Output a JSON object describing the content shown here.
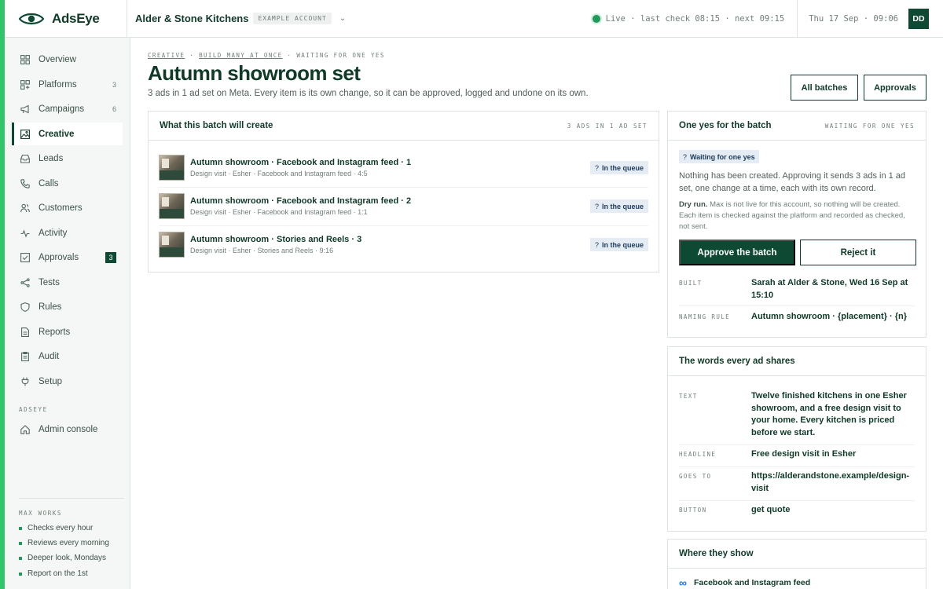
{
  "brand": {
    "name": "AdsEye"
  },
  "account": {
    "name": "Alder & Stone Kitchens",
    "tag": "EXAMPLE ACCOUNT"
  },
  "status": {
    "live_text": "Live · last check 08:15 · next 09:15",
    "datetime": "Thu 17 Sep · 09:06",
    "avatar": "DD"
  },
  "sidebar": {
    "items": [
      {
        "label": "Overview",
        "icon": "grid-icon"
      },
      {
        "label": "Platforms",
        "icon": "platforms-icon",
        "count": "3"
      },
      {
        "label": "Campaigns",
        "icon": "megaphone-icon",
        "count": "6"
      },
      {
        "label": "Creative",
        "icon": "image-icon",
        "active": true
      },
      {
        "label": "Leads",
        "icon": "inbox-icon"
      },
      {
        "label": "Calls",
        "icon": "phone-icon"
      },
      {
        "label": "Customers",
        "icon": "people-icon"
      },
      {
        "label": "Activity",
        "icon": "pulse-icon"
      },
      {
        "label": "Approvals",
        "icon": "checkbox-icon",
        "badge": "3"
      },
      {
        "label": "Tests",
        "icon": "branch-icon"
      },
      {
        "label": "Rules",
        "icon": "shield-icon"
      },
      {
        "label": "Reports",
        "icon": "document-icon"
      },
      {
        "label": "Audit",
        "icon": "clipboard-icon"
      },
      {
        "label": "Setup",
        "icon": "plug-icon"
      }
    ],
    "section_label": "ADSEYE",
    "admin_label": "Admin console",
    "works_label": "MAX WORKS",
    "works": [
      "Checks every hour",
      "Reviews every morning",
      "Deeper look, Mondays",
      "Report on the 1st"
    ]
  },
  "breadcrumb": {
    "c1": "CREATIVE",
    "c2": "BUILD MANY AT ONCE",
    "c3": "WAITING FOR ONE YES",
    "sep": "·"
  },
  "page": {
    "title": "Autumn showroom set",
    "subtitle": "3 ads in 1 ad set on Meta. Every item is its own change, so it can be approved, logged and undone on its own.",
    "btn_batches": "All batches",
    "btn_approvals": "Approvals"
  },
  "batch": {
    "title": "What this batch will create",
    "meta": "3 ADS IN 1 AD SET",
    "rows": [
      {
        "title": "Autumn showroom · Facebook and Instagram feed · 1",
        "sub": "Design visit · Esher · Facebook and Instagram feed · 4:5",
        "status": "In the queue"
      },
      {
        "title": "Autumn showroom · Facebook and Instagram feed · 2",
        "sub": "Design visit · Esher · Facebook and Instagram feed · 1:1",
        "status": "In the queue"
      },
      {
        "title": "Autumn showroom · Stories and Reels · 3",
        "sub": "Design visit · Esher · Stories and Reels · 9:16",
        "status": "In the queue"
      }
    ]
  },
  "approval": {
    "title": "One yes for the batch",
    "meta": "WAITING FOR ONE YES",
    "pill": "Waiting for one yes",
    "para": "Nothing has been created. Approving it sends 3 ads in 1 ad set, one change at a time, each with its own record.",
    "dry_lead": "Dry run.",
    "dry_text": "Max is not live for this account, so nothing will be created. Each item is checked against the platform and recorded as checked, not sent.",
    "approve_label": "Approve the batch",
    "reject_label": "Reject it",
    "built_label": "BUILT",
    "built_value": "Sarah at Alder & Stone, Wed 16 Sep at 15:10",
    "naming_label": "NAMING RULE",
    "naming_value": "Autumn showroom · {placement} · {n}"
  },
  "words": {
    "title": "The words every ad shares",
    "text_label": "TEXT",
    "text_value": "Twelve finished kitchens in one Esher showroom, and a free design visit to your home. Every kitchen is priced before we start.",
    "headline_label": "HEADLINE",
    "headline_value": "Free design visit in Esher",
    "goes_label": "GOES TO",
    "goes_value": "https://alderandstone.example/design-visit",
    "button_label": "BUTTON",
    "button_value": "get quote"
  },
  "where": {
    "title": "Where they show",
    "item": "Facebook and Instagram feed"
  },
  "colors": {
    "accent": "#33c46b",
    "brand": "#0e4a33",
    "queue_pill": "#e6ecf3"
  }
}
